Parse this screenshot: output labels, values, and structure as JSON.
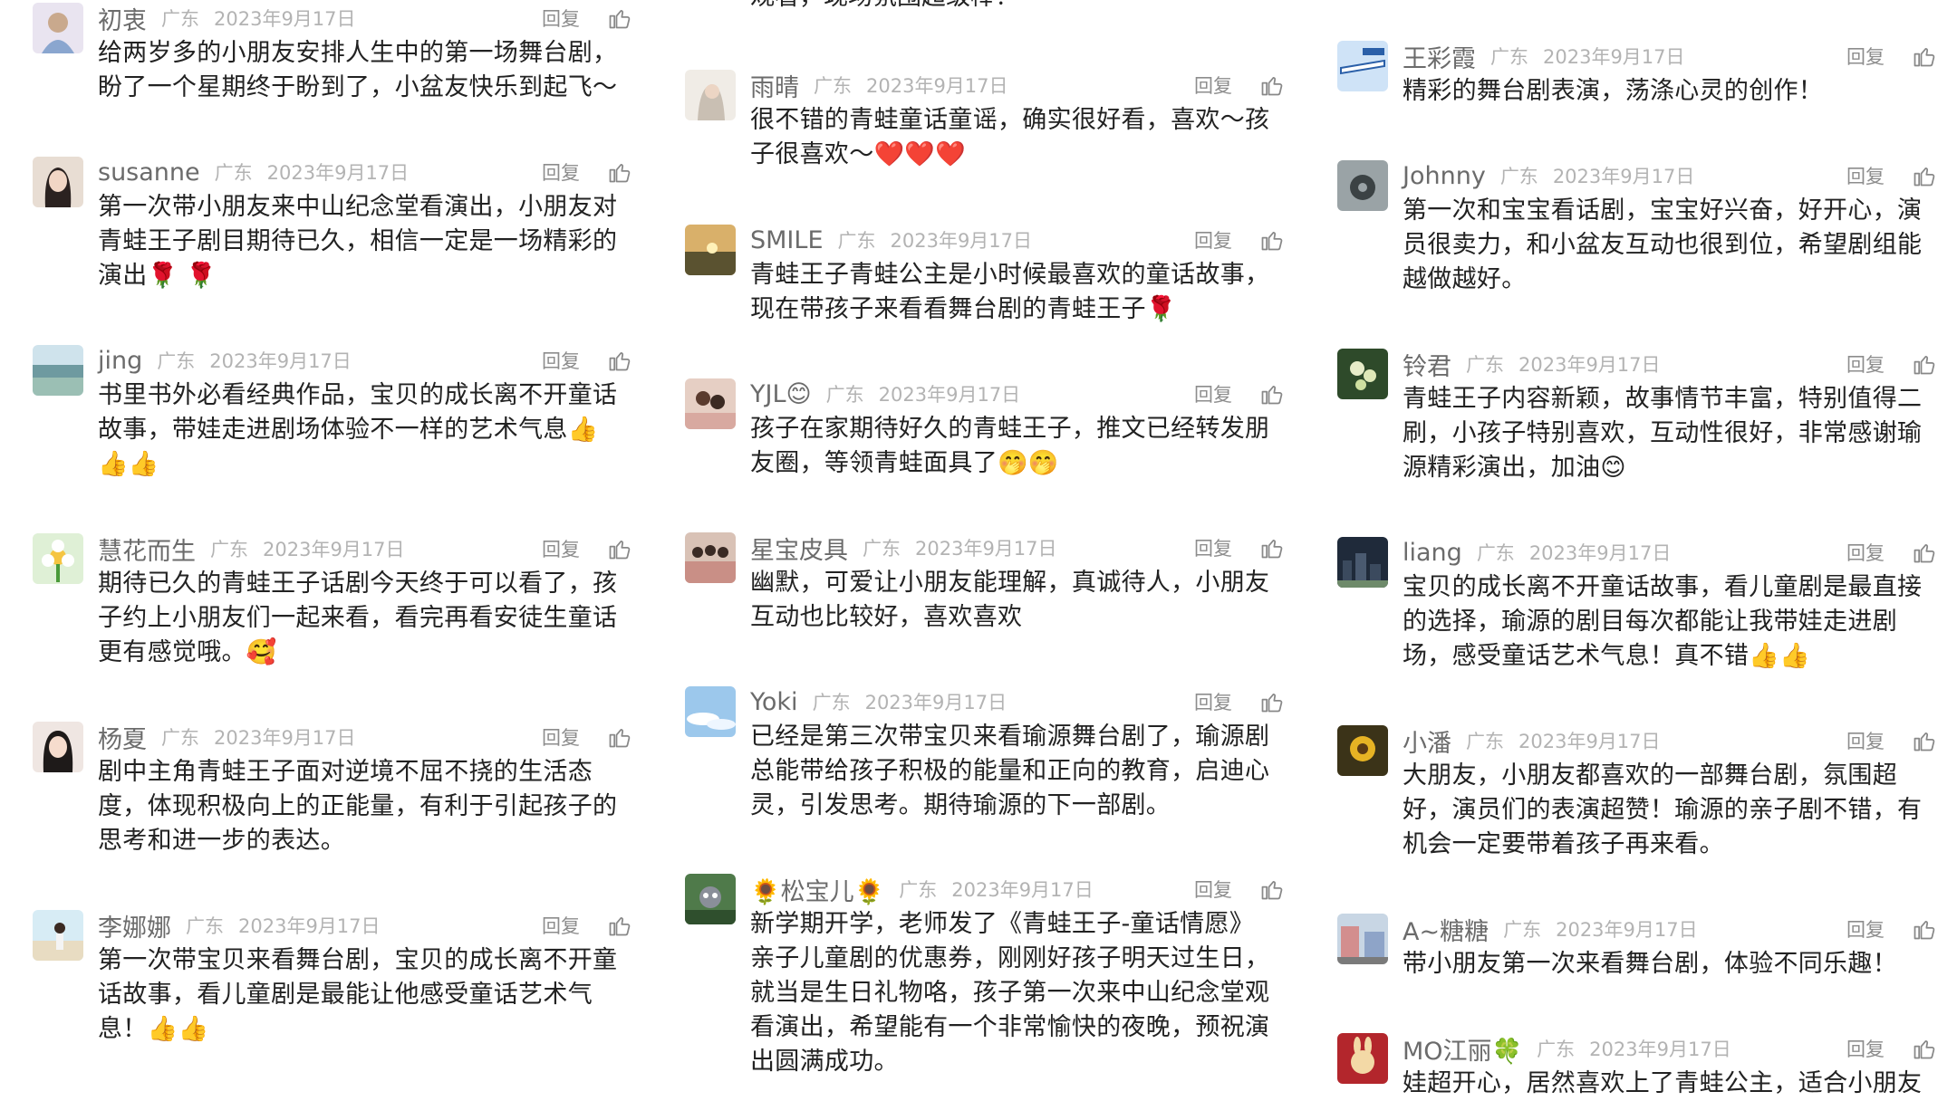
{
  "reply_label": "回复",
  "left": [
    {
      "user": "初衷",
      "region": "广东",
      "date": "2023年9月17日",
      "text": "给两岁多的小朋友安排人生中的第一场舞台剧，盼了一个星期终于盼到了，小盆友快乐到起飞～",
      "emoji": ""
    },
    {
      "user": "susanne",
      "region": "广东",
      "date": "2023年9月17日",
      "text": "第一次带小朋友来中山纪念堂看演出，小朋友对青蛙王子剧目期待已久，相信一定是一场精彩的演出",
      "emoji": "🌹 🌹"
    },
    {
      "user": "jing",
      "region": "广东",
      "date": "2023年9月17日",
      "text": "书里书外必看经典作品，宝贝的成长离不开童话故事，带娃走进剧场体验不一样的艺术气息",
      "emoji": "👍👍👍"
    },
    {
      "user": "慧花而生",
      "region": "广东",
      "date": "2023年9月17日",
      "text": "期待已久的青蛙王子话剧今天终于可以看了，孩子约上小朋友们一起来看，看完再看安徒生童话更有感觉哦。",
      "emoji": "🥰"
    },
    {
      "user": "杨夏",
      "region": "广东",
      "date": "2023年9月17日",
      "text": "剧中主角青蛙王子面对逆境不屈不挠的生活态度，体现积极向上的正能量，有利于引起孩子的思考和进一步的表达。",
      "emoji": ""
    },
    {
      "user": "李娜娜",
      "region": "广东",
      "date": "2023年9月17日",
      "text": "第一次带宝贝来看舞台剧，宝贝的成长离不开童话故事，看儿童剧是最能让他感受童话艺术气息！",
      "emoji": "👍👍"
    }
  ],
  "middle_top_fragment": "观看，现场氛围超级棒！",
  "middle": [
    {
      "user": "雨晴",
      "region": "广东",
      "date": "2023年9月17日",
      "text": "很不错的青蛙童话童谣，确实很好看，喜欢～孩子很喜欢～",
      "emoji": "❤️❤️❤️"
    },
    {
      "user": "SMILE",
      "region": "广东",
      "date": "2023年9月17日",
      "text": "青蛙王子青蛙公主是小时候最喜欢的童话故事，现在带孩子来看看舞台剧的青蛙王子",
      "emoji": "🌹"
    },
    {
      "user": "YJL😊",
      "region": "广东",
      "date": "2023年9月17日",
      "text": "孩子在家期待好久的青蛙王子，推文已经转发朋友圈，等领青蛙面具了",
      "emoji": "🤭🤭"
    },
    {
      "user": "星宝皮具",
      "region": "广东",
      "date": "2023年9月17日",
      "text": "幽默，可爱让小朋友能理解，真诚待人，小朋友互动也比较好，喜欢喜欢",
      "emoji": ""
    },
    {
      "user": "Yoki",
      "region": "广东",
      "date": "2023年9月17日",
      "text": "已经是第三次带宝贝来看瑜源舞台剧了，瑜源剧总能带给孩子积极的能量和正向的教育，启迪心灵，引发思考。期待瑜源的下一部剧。",
      "emoji": ""
    },
    {
      "user": "🌻松宝儿🌻",
      "region": "广东",
      "date": "2023年9月17日",
      "text": "新学期开学，老师发了《青蛙王子-童话情愿》亲子儿童剧的优惠券，刚刚好孩子明天过生日，就当是生日礼物咯，孩子第一次来中山纪念堂观看演出，希望能有一个非常愉快的夜晚，预祝演出圆满成功。",
      "emoji": ""
    }
  ],
  "right": [
    {
      "user": "王彩霞",
      "region": "广东",
      "date": "2023年9月17日",
      "text": "精彩的舞台剧表演，荡涤心灵的创作！",
      "emoji": ""
    },
    {
      "user": "Johnny",
      "region": "广东",
      "date": "2023年9月17日",
      "text": "第一次和宝宝看话剧，宝宝好兴奋，好开心，演员很卖力，和小盆友互动也很到位，希望剧组能越做越好。",
      "emoji": ""
    },
    {
      "user": "铃君",
      "region": "广东",
      "date": "2023年9月17日",
      "text": "青蛙王子内容新颖，故事情节丰富，特别值得二刷，小孩子特别喜欢，互动性很好，非常感谢瑜源精彩演出，加油",
      "emoji": "😊"
    },
    {
      "user": "liang",
      "region": "广东",
      "date": "2023年9月17日",
      "text": "宝贝的成长离不开童话故事，看儿童剧是最直接的选择，瑜源的剧目每次都能让我带娃走进剧场，感受童话艺术气息！真不错",
      "emoji": "👍👍"
    },
    {
      "user": "小潘",
      "region": "广东",
      "date": "2023年9月17日",
      "text": "大朋友，小朋友都喜欢的一部舞台剧，氛围超好，演员们的表演超赞！瑜源的亲子剧不错，有机会一定要带着孩子再来看。",
      "emoji": ""
    },
    {
      "user": "A~糖糖",
      "region": "广东",
      "date": "2023年9月17日",
      "text": "带小朋友第一次来看舞台剧，体验不同乐趣！",
      "emoji": ""
    },
    {
      "user": "MO江丽🍀",
      "region": "广东",
      "date": "2023年9月17日",
      "text": "娃超开心，居然喜欢上了青蛙公主，适合小朋友",
      "emoji": ""
    }
  ],
  "avatar_icons": {
    "left": [
      "girl-illustration-icon",
      "woman-portrait-icon",
      "lake-landscape-icon",
      "flower-cartoon-icon",
      "woman-portrait-icon",
      "beach-girl-icon"
    ],
    "middle": [
      "girl-portrait-icon",
      "sunset-landscape-icon",
      "girls-photo-icon",
      "group-photo-icon",
      "sky-landscape-icon",
      "cartoon-character-icon"
    ],
    "right": [
      "airplane-icon",
      "car-interior-icon",
      "flower-plant-icon",
      "night-city-icon",
      "sunflower-icon",
      "street-scene-icon",
      "rabbit-cartoon-icon"
    ]
  }
}
